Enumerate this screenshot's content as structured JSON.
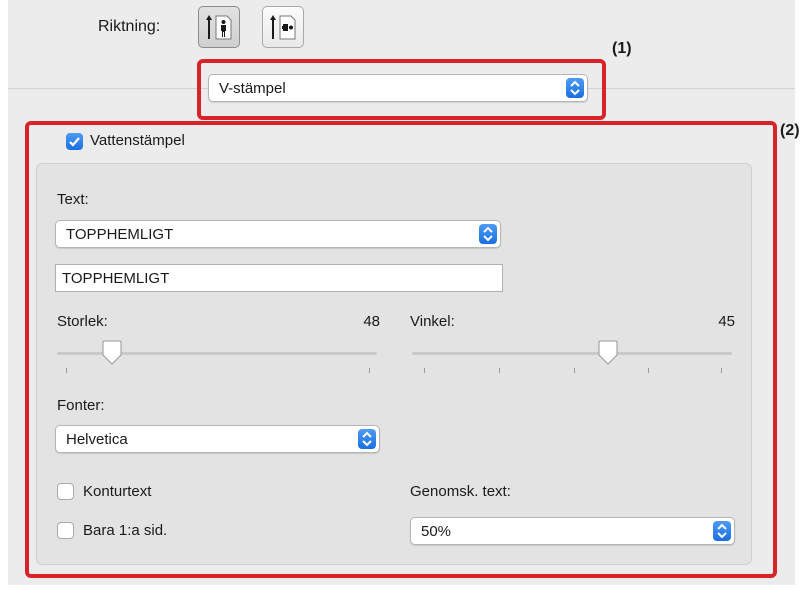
{
  "orientation": {
    "label": "Riktning:",
    "buttons": [
      {
        "name": "portrait",
        "active": true
      },
      {
        "name": "landscape",
        "active": false
      }
    ]
  },
  "stamp_select": {
    "value": "V-stämpel"
  },
  "callouts": {
    "one": "(1)",
    "two": "(2)"
  },
  "watermark": {
    "checkbox_label": "Vattenstämpel",
    "checked": true,
    "text_label": "Text:",
    "text_select_value": "TOPPHEMLIGT",
    "text_field_value": "TOPPHEMLIGT",
    "size": {
      "label": "Storlek:",
      "value": "48"
    },
    "angle": {
      "label": "Vinkel:",
      "value": "45"
    },
    "font_label": "Fonter:",
    "font_value": "Helvetica",
    "outline_label": "Konturtext",
    "outline_checked": false,
    "first_page_label": "Bara 1:a sid.",
    "first_page_checked": false,
    "transparency_label": "Genomsk. text:",
    "transparency_value": "50%"
  },
  "colors": {
    "accent": "#1a6fe0",
    "callout": "#d8232a"
  }
}
